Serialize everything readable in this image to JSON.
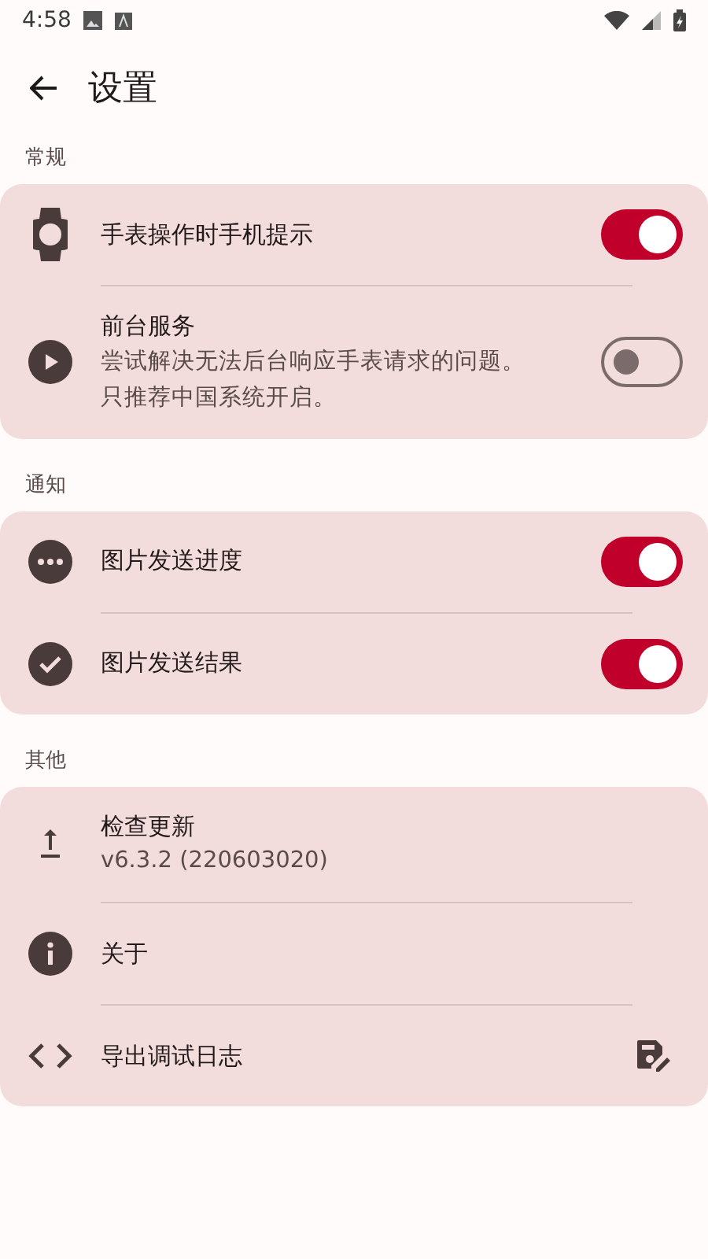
{
  "status_bar": {
    "time": "4:58"
  },
  "title": "设置",
  "sections": [
    {
      "header": "常规",
      "items": [
        {
          "kind": "toggle",
          "title": "手表操作时手机提示",
          "on": true
        },
        {
          "kind": "toggle",
          "title": "前台服务",
          "subtitle": "尝试解决无法后台响应手表请求的问题。只推荐中国系统开启。",
          "on": false
        }
      ]
    },
    {
      "header": "通知",
      "items": [
        {
          "kind": "toggle",
          "title": "图片发送进度",
          "on": true
        },
        {
          "kind": "toggle",
          "title": "图片发送结果",
          "on": true
        }
      ]
    },
    {
      "header": "其他",
      "items": [
        {
          "kind": "plain",
          "title": "检查更新",
          "subtitle": "v6.3.2 (220603020)"
        },
        {
          "kind": "plain",
          "title": "关于"
        },
        {
          "kind": "action",
          "title": "导出调试日志"
        }
      ]
    }
  ]
}
